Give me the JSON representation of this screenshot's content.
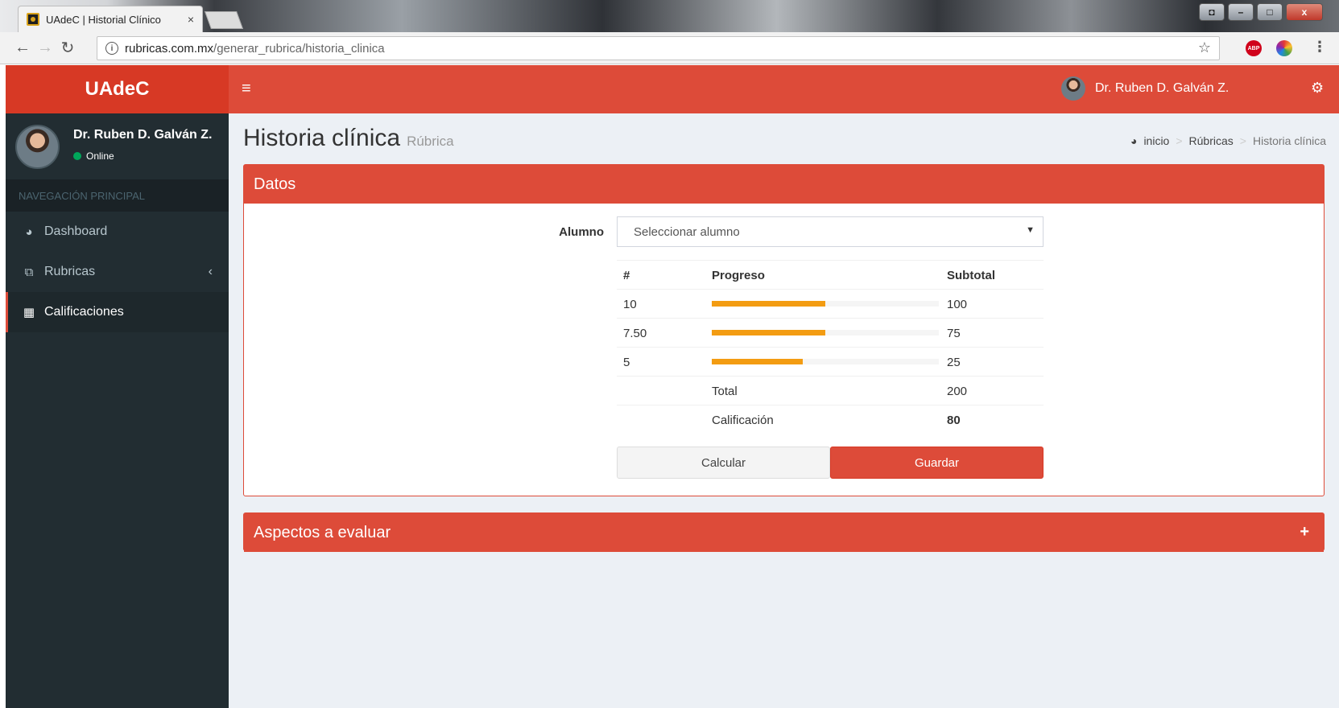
{
  "browser": {
    "tab_title": "UAdeC | Historial Clínico",
    "tab_close": "×",
    "url_host": "rubricas.com.mx",
    "url_path": "/generar_rubrica/historia_clinica",
    "info_glyph": "i",
    "abp_label": "ABP"
  },
  "app": {
    "logo": "UAdeC",
    "topbar_user": "Dr. Ruben D. Galván Z."
  },
  "sidebar": {
    "user_name": "Dr. Ruben D. Galván Z.",
    "status": "Online",
    "nav_header": "NAVEGACIÓN PRINCIPAL",
    "items": [
      {
        "label": "Dashboard",
        "icon": "dashboard-icon"
      },
      {
        "label": "Rubricas",
        "icon": "copy-icon"
      },
      {
        "label": "Calificaciones",
        "icon": "table-icon"
      }
    ]
  },
  "page": {
    "title": "Historia clínica",
    "subtitle": "Rúbrica",
    "breadcrumb": [
      "inicio",
      "Rúbricas",
      "Historia clínica"
    ]
  },
  "datos": {
    "header": "Datos",
    "alumno_label": "Alumno",
    "select_value": "Seleccionar alumno",
    "table": {
      "headers": [
        "#",
        "Progreso",
        "Subtotal"
      ],
      "rows": [
        {
          "num": "10",
          "progress": 0.5,
          "subtotal": "100"
        },
        {
          "num": "7.50",
          "progress": 0.5,
          "subtotal": "75"
        },
        {
          "num": "5",
          "progress": 0.4,
          "subtotal": "25"
        }
      ],
      "total_label": "Total",
      "total_value": "200",
      "grade_label": "Calificación",
      "grade_value": "80"
    },
    "calc_button": "Calcular",
    "save_button": "Guardar"
  },
  "aspectos": {
    "header": "Aspectos a evaluar",
    "toggle": "+"
  },
  "colors": {
    "brand_red": "#dd4b39",
    "sidebar_dark": "#222d32",
    "progress_orange": "#f39c12",
    "online_green": "#00a65a"
  }
}
